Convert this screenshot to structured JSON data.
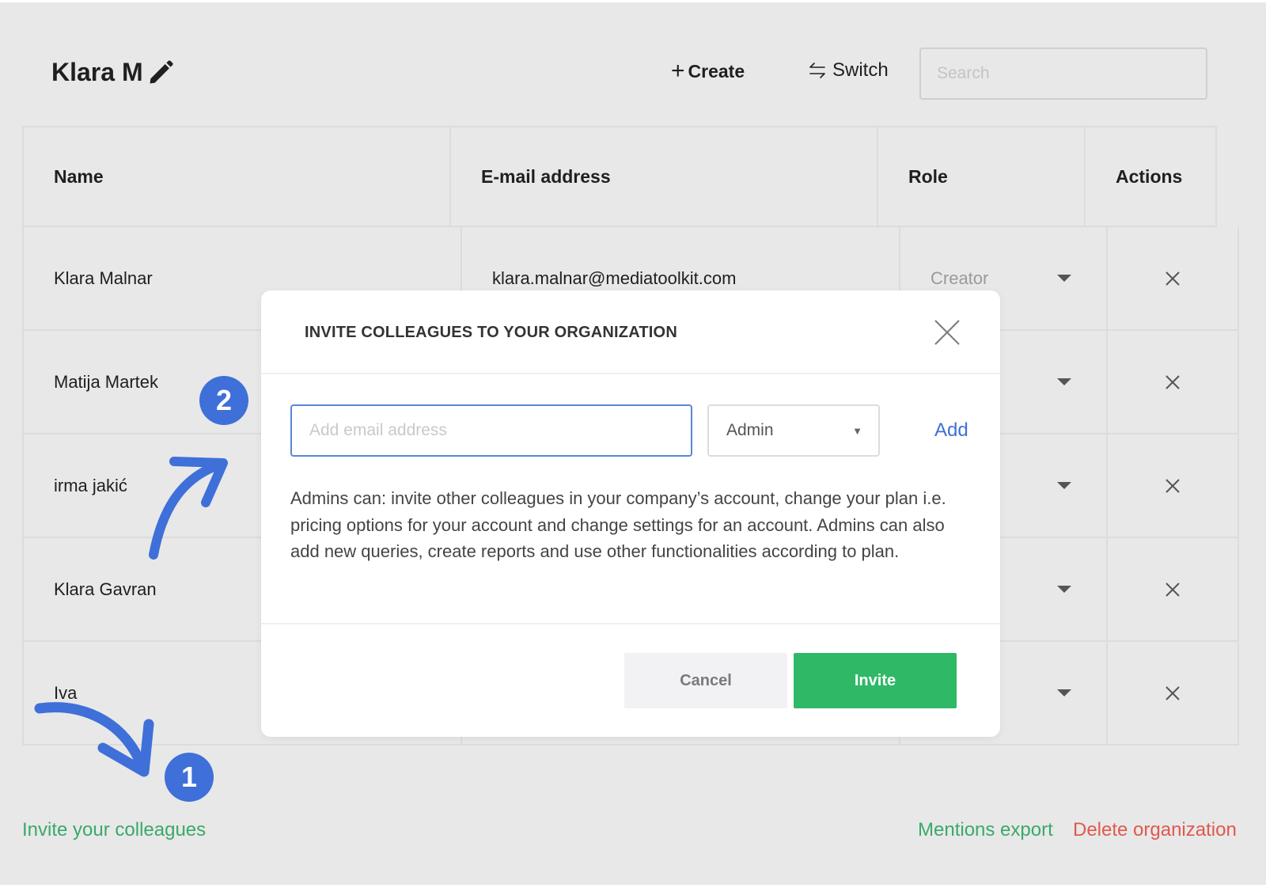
{
  "header": {
    "org_name": "Klara M",
    "create_label": "Create",
    "switch_label": "Switch",
    "search_placeholder": "Search"
  },
  "table": {
    "columns": [
      "Name",
      "E-mail address",
      "Role",
      "Actions"
    ],
    "rows": [
      {
        "name": "Klara Malnar",
        "email": "klara.malnar@mediatoolkit.com",
        "role": "Creator"
      },
      {
        "name": "Matija Martek",
        "email": "",
        "role": ""
      },
      {
        "name": "irma jakić",
        "email": "",
        "role": ""
      },
      {
        "name": "Klara Gavran",
        "email": "",
        "role": ""
      },
      {
        "name": "Iva",
        "email": "",
        "role": ""
      }
    ]
  },
  "footer": {
    "invite_label": "Invite your colleagues",
    "export_label": "Mentions export",
    "delete_label": "Delete organization"
  },
  "annotations": {
    "step1": "1",
    "step2": "2"
  },
  "modal": {
    "title": "INVITE COLLEAGUES TO YOUR ORGANIZATION",
    "email_placeholder": "Add email address",
    "role_selected": "Admin",
    "add_label": "Add",
    "description": "Admins can: invite other colleagues in your company’s account, change your plan i.e. pricing options for your account and change settings for an account. Admins can also add new queries, create reports and use other functionalities according to plan.",
    "cancel_label": "Cancel",
    "invite_label": "Invite"
  },
  "colors": {
    "accent_green": "#2fb866",
    "link_green": "#3aa96a",
    "danger_red": "#e0584e",
    "annotation_blue": "#3f6fd8"
  }
}
